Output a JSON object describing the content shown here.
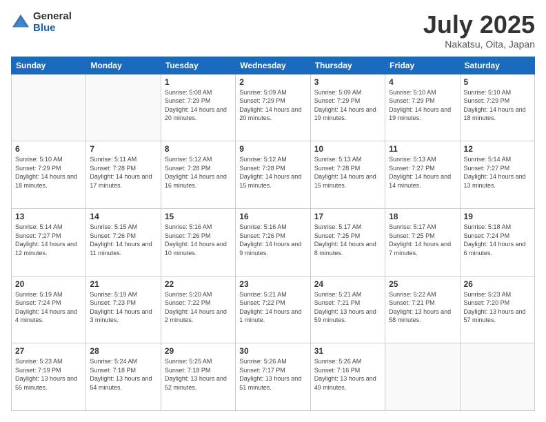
{
  "header": {
    "logo_general": "General",
    "logo_blue": "Blue",
    "month_title": "July 2025",
    "location": "Nakatsu, Oita, Japan"
  },
  "weekdays": [
    "Sunday",
    "Monday",
    "Tuesday",
    "Wednesday",
    "Thursday",
    "Friday",
    "Saturday"
  ],
  "weeks": [
    [
      {
        "day": "",
        "info": ""
      },
      {
        "day": "",
        "info": ""
      },
      {
        "day": "1",
        "info": "Sunrise: 5:08 AM\nSunset: 7:29 PM\nDaylight: 14 hours and 20 minutes."
      },
      {
        "day": "2",
        "info": "Sunrise: 5:09 AM\nSunset: 7:29 PM\nDaylight: 14 hours and 20 minutes."
      },
      {
        "day": "3",
        "info": "Sunrise: 5:09 AM\nSunset: 7:29 PM\nDaylight: 14 hours and 19 minutes."
      },
      {
        "day": "4",
        "info": "Sunrise: 5:10 AM\nSunset: 7:29 PM\nDaylight: 14 hours and 19 minutes."
      },
      {
        "day": "5",
        "info": "Sunrise: 5:10 AM\nSunset: 7:29 PM\nDaylight: 14 hours and 18 minutes."
      }
    ],
    [
      {
        "day": "6",
        "info": "Sunrise: 5:10 AM\nSunset: 7:29 PM\nDaylight: 14 hours and 18 minutes."
      },
      {
        "day": "7",
        "info": "Sunrise: 5:11 AM\nSunset: 7:28 PM\nDaylight: 14 hours and 17 minutes."
      },
      {
        "day": "8",
        "info": "Sunrise: 5:12 AM\nSunset: 7:28 PM\nDaylight: 14 hours and 16 minutes."
      },
      {
        "day": "9",
        "info": "Sunrise: 5:12 AM\nSunset: 7:28 PM\nDaylight: 14 hours and 15 minutes."
      },
      {
        "day": "10",
        "info": "Sunrise: 5:13 AM\nSunset: 7:28 PM\nDaylight: 14 hours and 15 minutes."
      },
      {
        "day": "11",
        "info": "Sunrise: 5:13 AM\nSunset: 7:27 PM\nDaylight: 14 hours and 14 minutes."
      },
      {
        "day": "12",
        "info": "Sunrise: 5:14 AM\nSunset: 7:27 PM\nDaylight: 14 hours and 13 minutes."
      }
    ],
    [
      {
        "day": "13",
        "info": "Sunrise: 5:14 AM\nSunset: 7:27 PM\nDaylight: 14 hours and 12 minutes."
      },
      {
        "day": "14",
        "info": "Sunrise: 5:15 AM\nSunset: 7:26 PM\nDaylight: 14 hours and 11 minutes."
      },
      {
        "day": "15",
        "info": "Sunrise: 5:16 AM\nSunset: 7:26 PM\nDaylight: 14 hours and 10 minutes."
      },
      {
        "day": "16",
        "info": "Sunrise: 5:16 AM\nSunset: 7:26 PM\nDaylight: 14 hours and 9 minutes."
      },
      {
        "day": "17",
        "info": "Sunrise: 5:17 AM\nSunset: 7:25 PM\nDaylight: 14 hours and 8 minutes."
      },
      {
        "day": "18",
        "info": "Sunrise: 5:17 AM\nSunset: 7:25 PM\nDaylight: 14 hours and 7 minutes."
      },
      {
        "day": "19",
        "info": "Sunrise: 5:18 AM\nSunset: 7:24 PM\nDaylight: 14 hours and 6 minutes."
      }
    ],
    [
      {
        "day": "20",
        "info": "Sunrise: 5:19 AM\nSunset: 7:24 PM\nDaylight: 14 hours and 4 minutes."
      },
      {
        "day": "21",
        "info": "Sunrise: 5:19 AM\nSunset: 7:23 PM\nDaylight: 14 hours and 3 minutes."
      },
      {
        "day": "22",
        "info": "Sunrise: 5:20 AM\nSunset: 7:22 PM\nDaylight: 14 hours and 2 minutes."
      },
      {
        "day": "23",
        "info": "Sunrise: 5:21 AM\nSunset: 7:22 PM\nDaylight: 14 hours and 1 minute."
      },
      {
        "day": "24",
        "info": "Sunrise: 5:21 AM\nSunset: 7:21 PM\nDaylight: 13 hours and 59 minutes."
      },
      {
        "day": "25",
        "info": "Sunrise: 5:22 AM\nSunset: 7:21 PM\nDaylight: 13 hours and 58 minutes."
      },
      {
        "day": "26",
        "info": "Sunrise: 5:23 AM\nSunset: 7:20 PM\nDaylight: 13 hours and 57 minutes."
      }
    ],
    [
      {
        "day": "27",
        "info": "Sunrise: 5:23 AM\nSunset: 7:19 PM\nDaylight: 13 hours and 55 minutes."
      },
      {
        "day": "28",
        "info": "Sunrise: 5:24 AM\nSunset: 7:18 PM\nDaylight: 13 hours and 54 minutes."
      },
      {
        "day": "29",
        "info": "Sunrise: 5:25 AM\nSunset: 7:18 PM\nDaylight: 13 hours and 52 minutes."
      },
      {
        "day": "30",
        "info": "Sunrise: 5:26 AM\nSunset: 7:17 PM\nDaylight: 13 hours and 51 minutes."
      },
      {
        "day": "31",
        "info": "Sunrise: 5:26 AM\nSunset: 7:16 PM\nDaylight: 13 hours and 49 minutes."
      },
      {
        "day": "",
        "info": ""
      },
      {
        "day": "",
        "info": ""
      }
    ]
  ]
}
